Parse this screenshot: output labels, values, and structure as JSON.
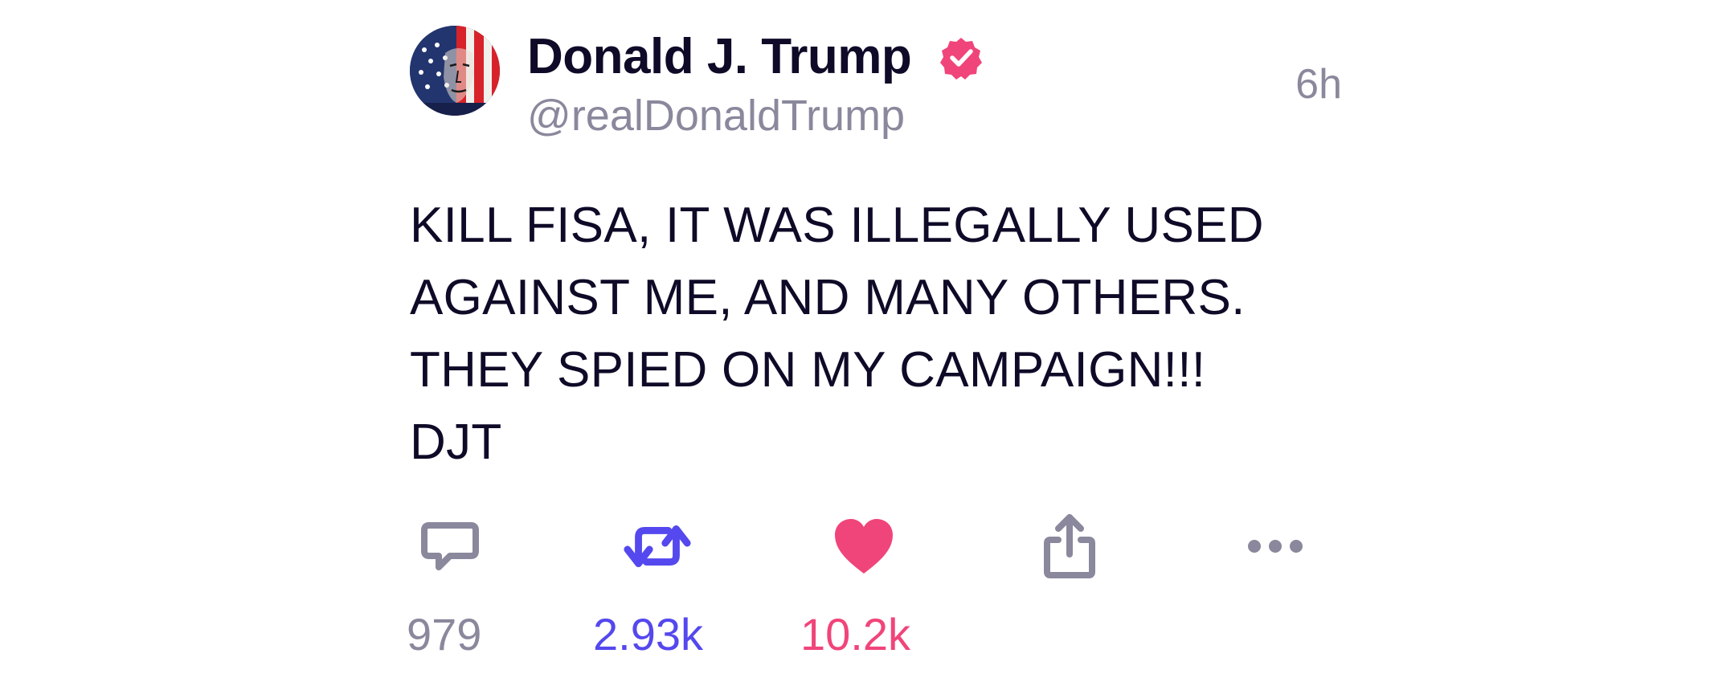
{
  "post": {
    "author": {
      "display_name": "Donald J. Trump",
      "handle": "@realDonaldTrump",
      "verified": true,
      "avatar": "flag-portrait-avatar"
    },
    "timestamp": "6h",
    "body_lines": [
      "KILL FISA, IT WAS ILLEGALLY USED",
      "AGAINST ME, AND MANY OTHERS.",
      "THEY SPIED ON MY CAMPAIGN!!!",
      "DJT"
    ],
    "actions": {
      "reply": {
        "icon": "reply-icon",
        "count": "979"
      },
      "repost": {
        "icon": "repost-icon",
        "count": "2.93k"
      },
      "like": {
        "icon": "heart-icon",
        "count": "10.2k"
      },
      "share": {
        "icon": "share-icon"
      },
      "more": {
        "icon": "more-icon"
      }
    }
  },
  "colors": {
    "text_primary": "#0e0a27",
    "text_secondary": "#8a889c",
    "repost_accent": "#5448ee",
    "like_accent": "#f0457a",
    "verified_badge": "#f0457a"
  }
}
